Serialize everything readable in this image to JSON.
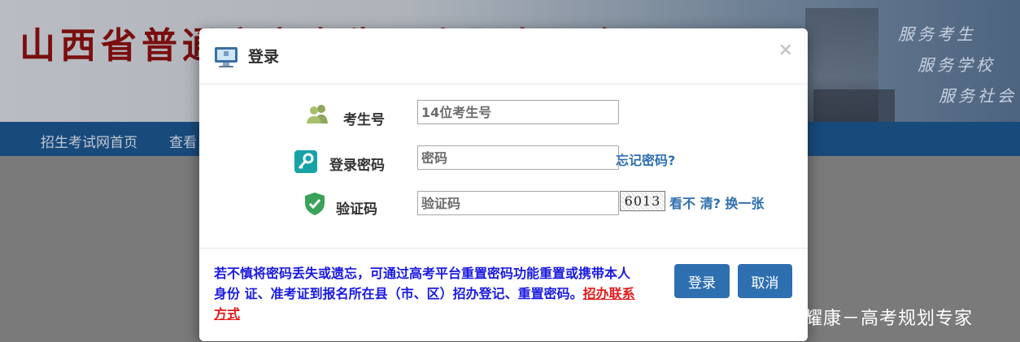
{
  "background": {
    "banner_title": "山西省普通高考考生网上服务平台",
    "slogans": [
      "服务考生",
      "服务学校",
      "服务社会"
    ],
    "nav": [
      "招生考试网首页",
      "查看"
    ],
    "watermark": "搜狐号@薛耀康－高考规划专家"
  },
  "modal": {
    "title": "登录",
    "close_symbol": "×",
    "icons": {
      "header": "monitor-icon",
      "candidate": "users-icon",
      "password": "key-icon",
      "captcha": "shield-check-icon"
    },
    "fields": {
      "candidate_label": "考生号",
      "candidate_placeholder": "14位考生号",
      "password_label": "登录密码",
      "password_placeholder": "密码",
      "forgot_password": "忘记密码?",
      "captcha_label": "验证码",
      "captcha_placeholder": "验证码",
      "captcha_image_text": "6013",
      "captcha_refresh": "看不 清? 换一张"
    },
    "notice_text": "若不慎将密码丢失或遗忘，可通过高考平台重置密码功能重置或携带本人身份 证、准考证到报名所在县（市、区）招办登记、重置密码。",
    "notice_link": "招办联系方式",
    "buttons": {
      "login": "登录",
      "cancel": "取消"
    }
  },
  "colors": {
    "nav_bg": "#184a7c",
    "button_bg": "#2e6fb0",
    "notice_text": "#1a1ae0",
    "notice_link": "#e01b1b",
    "banner_title": "#7a0f0f"
  }
}
